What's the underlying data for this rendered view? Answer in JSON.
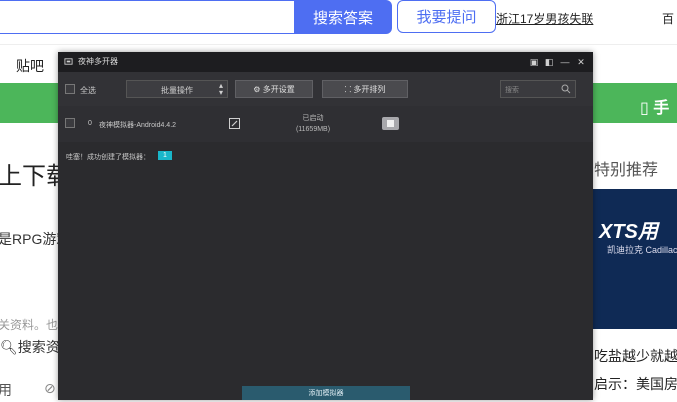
{
  "bg": {
    "search_button": "搜索答案",
    "ask_button": "我要提问",
    "hot_link": "浙江17岁男孩失联",
    "right_top": "百",
    "tieba": "贴吧",
    "green_right": "手",
    "left_title": "上下载",
    "left_rpg": "是RPG游戏",
    "left_gray": "关资料。也",
    "left_search": "搜索资",
    "left_bottom": "用",
    "rec_title": "特别推荐",
    "ad_logo": "XTS用",
    "ad_sub": "凯迪拉克 Cadillac",
    "news1": "吃盐越少就越",
    "news2": "启示：美国房"
  },
  "nox": {
    "title": "夜神多开器",
    "select_all": "全选",
    "batch_select": "批量操作",
    "settings_button": "⚙ 多开设置",
    "arrange_button": "⸬ 多开排列",
    "search_placeholder": "搜索",
    "instance": {
      "index": "0",
      "name": "夜神模拟器-Android4.4.2",
      "status": "已启动",
      "size": "(11659MB)"
    },
    "message": "哇塞！成功创建了模拟器：",
    "message_count": "1",
    "add_button": "添加模拟器"
  },
  "colors": {
    "accent": "#4e6ef2",
    "green_bar": "#4cb65a",
    "nox_bg": "#2b2b2e",
    "badge": "#19b6c9"
  }
}
